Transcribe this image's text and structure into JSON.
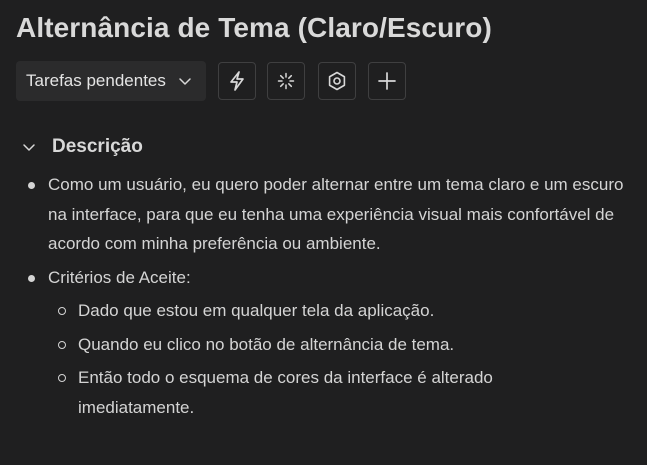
{
  "page": {
    "title": "Alternância de Tema (Claro/Escuro)"
  },
  "toolbar": {
    "status_label": "Tarefas pendentes",
    "buttons": [
      {
        "icon": "lightning-icon"
      },
      {
        "icon": "loading-spinner-icon"
      },
      {
        "icon": "hexagon-settings-icon"
      },
      {
        "icon": "plus-icon"
      }
    ]
  },
  "description": {
    "heading": "Descrição",
    "story": "Como um usuário, eu quero poder alternar entre um tema claro e um escuro na interface, para que eu tenha uma experiência visual mais confortável de acordo com minha preferência ou ambiente.",
    "criteria_label": "Critérios de Aceite:",
    "criteria": [
      "Dado que estou em qualquer tela da aplicação.",
      "Quando eu clico no botão de alternância de tema.",
      "Então todo o esquema de cores da interface é alterado imediatamente."
    ]
  },
  "colors": {
    "background": "#1f1f20",
    "text": "#d8d8d8",
    "button_border": "#3f3f40",
    "dropdown_bg": "#2b2b2c"
  }
}
